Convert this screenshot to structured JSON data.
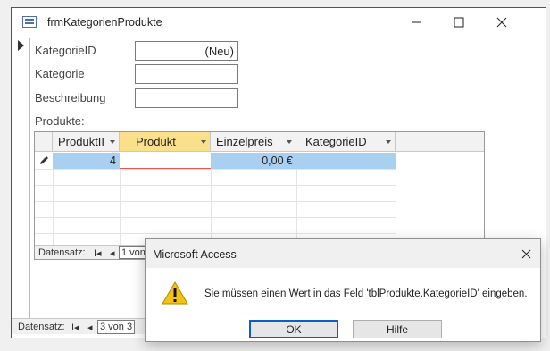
{
  "window": {
    "title": "frmKategorienProdukte"
  },
  "form": {
    "fields": [
      {
        "label": "KategorieID",
        "value": "(Neu)"
      },
      {
        "label": "Kategorie",
        "value": ""
      },
      {
        "label": "Beschreibung",
        "value": ""
      }
    ],
    "subform_label": "Produkte:"
  },
  "datasheet": {
    "columns": [
      "ProduktII",
      "Produkt",
      "Einzelpreis",
      "KategorieID"
    ],
    "rows": [
      {
        "ProduktID": "4",
        "Produkt": "",
        "Einzelpreis": "0,00 €",
        "KategorieID": ""
      }
    ]
  },
  "subform_nav": {
    "label": "Datensatz:",
    "first": "I◂",
    "prev": "◂",
    "record": "1 von"
  },
  "form_nav": {
    "label": "Datensatz:",
    "first": "I◂",
    "prev": "◂",
    "record": "3 von 3"
  },
  "dialog": {
    "title": "Microsoft Access",
    "message": "Sie müssen einen Wert in das Feld 'tblProdukte.KategorieID' eingeben.",
    "ok_label": "OK",
    "help_label": "Hilfe",
    "icon": "warning-icon",
    "warning_color": "#f2c314"
  }
}
